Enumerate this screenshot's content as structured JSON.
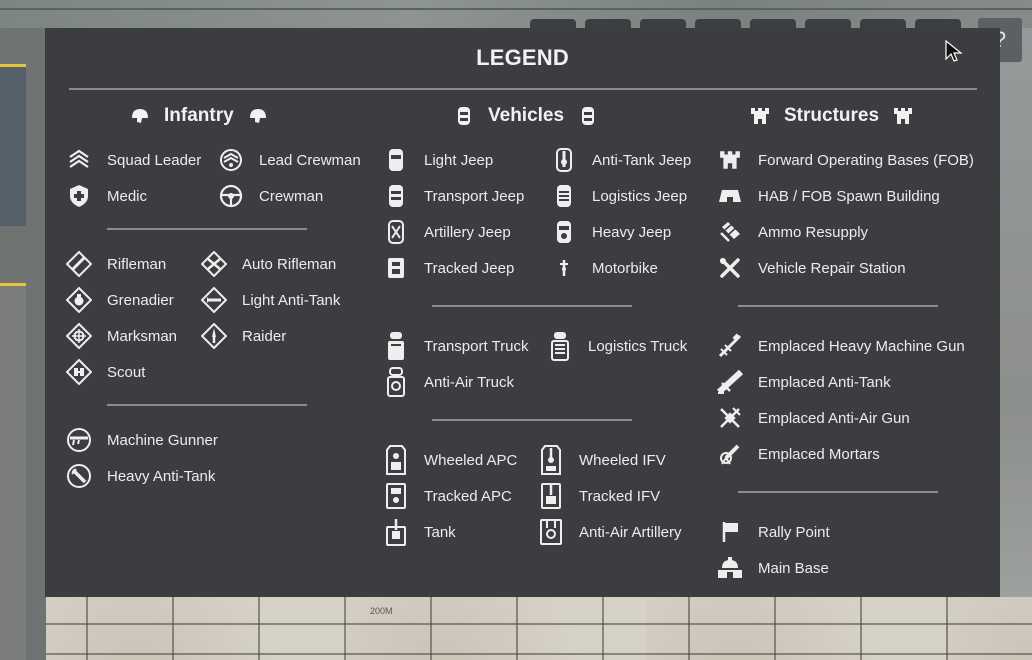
{
  "map": {
    "scale_label": "200M"
  },
  "hud": {
    "help_label": "?"
  },
  "legend": {
    "title": "LEGEND",
    "categories": {
      "infantry": "Infantry",
      "vehicles": "Vehicles",
      "structures": "Structures"
    },
    "infantry": {
      "squad_leader": "Squad Leader",
      "lead_crewman": "Lead Crewman",
      "medic": "Medic",
      "crewman": "Crewman",
      "rifleman": "Rifleman",
      "auto_rifleman": "Auto Rifleman",
      "grenadier": "Grenadier",
      "light_anti_tank": "Light Anti-Tank",
      "marksman": "Marksman",
      "raider": "Raider",
      "scout": "Scout",
      "machine_gunner": "Machine Gunner",
      "heavy_anti_tank": "Heavy Anti-Tank"
    },
    "vehicles": {
      "light_jeep": "Light Jeep",
      "anti_tank_jeep": "Anti-Tank Jeep",
      "transport_jeep": "Transport Jeep",
      "logistics_jeep": "Logistics Jeep",
      "artillery_jeep": "Artillery Jeep",
      "heavy_jeep": "Heavy Jeep",
      "tracked_jeep": "Tracked Jeep",
      "motorbike": "Motorbike",
      "transport_truck": "Transport Truck",
      "logistics_truck": "Logistics Truck",
      "anti_air_truck": "Anti-Air Truck",
      "wheeled_apc": "Wheeled APC",
      "wheeled_ifv": "Wheeled IFV",
      "tracked_apc": "Tracked APC",
      "tracked_ifv": "Tracked IFV",
      "tank": "Tank",
      "anti_air_artillery": "Anti-Air Artillery"
    },
    "structures": {
      "fob": "Forward Operating Bases (FOB)",
      "hab": "HAB / FOB Spawn Building",
      "ammo": "Ammo Resupply",
      "repair": "Vehicle Repair Station",
      "emplaced_hmg": "Emplaced Heavy Machine Gun",
      "emplaced_at": "Emplaced Anti-Tank",
      "emplaced_aa": "Emplaced Anti-Air Gun",
      "emplaced_mortars": "Emplaced Mortars",
      "rally_point": "Rally Point",
      "main_base": "Main Base"
    }
  }
}
